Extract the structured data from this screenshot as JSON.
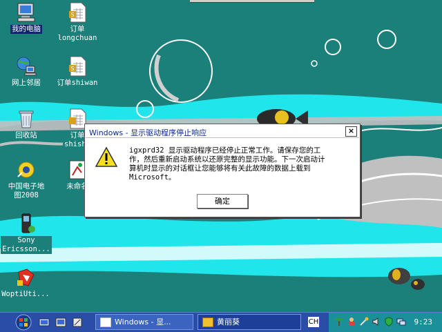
{
  "desktop_icons": [
    {
      "id": "my-computer",
      "label": "我的电脑",
      "icon": "computer-icon",
      "selected": true
    },
    {
      "id": "order-longchuan",
      "label": "订单\nlongchuan",
      "icon": "spreadsheet-icon"
    },
    {
      "id": "network",
      "label": "网上邻居",
      "icon": "network-icon"
    },
    {
      "id": "order-shiwan",
      "label": "订单shiwan",
      "icon": "spreadsheet-icon"
    },
    {
      "id": "recycle-bin",
      "label": "回收站",
      "icon": "recycle-bin-icon"
    },
    {
      "id": "order-shishe",
      "label": "订单\nshishe",
      "icon": "spreadsheet-icon"
    },
    {
      "id": "china-map",
      "label": "中国电子地\n图2008",
      "icon": "map-app-icon"
    },
    {
      "id": "unnamed",
      "label": "未命名",
      "icon": "image-file-icon"
    },
    {
      "id": "sony-ericsson",
      "label": "Sony\nEricsson...",
      "icon": "phone-icon"
    },
    {
      "id": "woptiuti",
      "label": "WoptiUti...",
      "icon": "optimizer-icon"
    }
  ],
  "dialog": {
    "title": "Windows - 显示驱动程序停止响应",
    "close_label": "×",
    "icon": "warning-icon",
    "message": "igxprd32 显示驱动程序已经停止正常工作。请保存您的工\n作，然后重新启动系统以还原完整的显示功能。下一次启动计\n算机时显示的对话框让您能够将有关此故障的数据上载到\nMicrosoft。",
    "ok_label": "确定"
  },
  "taskbar": {
    "start_icon": "start-orb-icon",
    "quick_launch": [
      "show-desktop-icon",
      "media-icon",
      "ie-icon"
    ],
    "tasks": [
      {
        "label": "Windows - 显...",
        "active": true
      },
      {
        "label": "黄丽葵",
        "active": false
      }
    ],
    "ime": "CH",
    "tray_icons": [
      "palm-icon",
      "figure-icon",
      "tools-icon",
      "speaker-icon",
      "shield-icon",
      "network-tray-icon"
    ],
    "clock": "9:23"
  },
  "colors": {
    "desktop": "#1b7f7a",
    "taskbar": "#2a4ea8",
    "tray": "#1b8f9a",
    "dialog_title": "#0a2a8a"
  }
}
